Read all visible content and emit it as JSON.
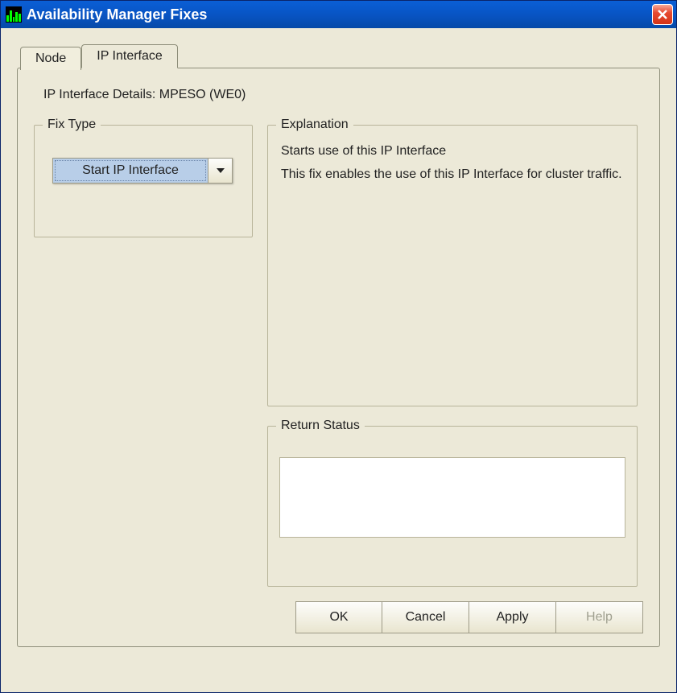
{
  "window": {
    "title": "Availability Manager Fixes"
  },
  "tabs": {
    "node": "Node",
    "ip_interface": "IP Interface"
  },
  "details_label": "IP Interface Details: MPESO  (WE0)",
  "fix_type": {
    "group_label": "Fix Type",
    "selected": "Start IP Interface"
  },
  "explanation": {
    "group_label": "Explanation",
    "line1": "Starts use of this IP Interface",
    "body": "This fix enables the use of this IP Interface for cluster traffic."
  },
  "return_status": {
    "group_label": "Return Status",
    "value": ""
  },
  "buttons": {
    "ok": "OK",
    "cancel": "Cancel",
    "apply": "Apply",
    "help": "Help"
  }
}
